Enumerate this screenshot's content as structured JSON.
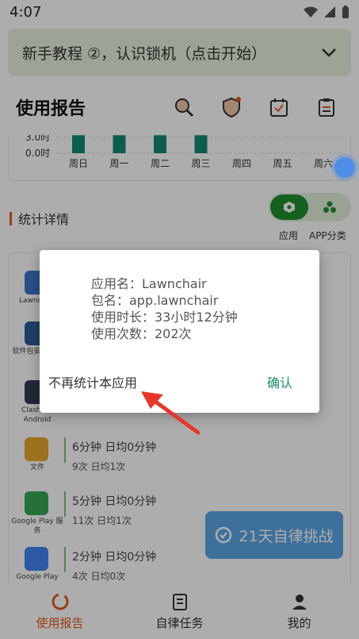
{
  "status_bar": {
    "time": "4:07"
  },
  "banner": {
    "text": "新手教程 ②，认识锁机（点击开始）"
  },
  "header": {
    "title": "使用报告",
    "tools": [
      "search-icon",
      "shield-icon",
      "calendar-check-icon",
      "clipboard-icon"
    ]
  },
  "chart_data": {
    "type": "bar",
    "categories": [
      "周日",
      "周一",
      "周二",
      "周三",
      "周四",
      "周五",
      "周六"
    ],
    "values": [
      3.4,
      3.4,
      3.4,
      3.4,
      0,
      0,
      0
    ],
    "ytick_labels": [
      "3.0时",
      "0.0时"
    ],
    "color": "#138a72"
  },
  "stats": {
    "title": "统计详情",
    "toggle_labels": [
      "应用",
      "APP分类"
    ]
  },
  "apps": [
    {
      "name": "Lawnchair",
      "duration": "",
      "count": "",
      "color": "#3b77c9"
    },
    {
      "name": "软件包安装程序",
      "duration": "",
      "count": "",
      "color": "#2d5f98"
    },
    {
      "name": "Clash for Android",
      "duration": "",
      "count": "",
      "color": "#2e3a55"
    },
    {
      "name": "文件",
      "duration": "6分钟  日均0分钟",
      "count": "9次  日均1次",
      "color": "#e9a72b"
    },
    {
      "name": "Google Play 服务",
      "duration": "5分钟  日均0分钟",
      "count": "11次  日均1次",
      "color": "#35a853"
    },
    {
      "name": "Google Play",
      "duration": "2分钟  日均0分钟",
      "count": "4次  日均0次",
      "color": "#4285f4"
    }
  ],
  "dialog": {
    "app_name": "应用名：Lawnchair",
    "package": "包名：app.lawnchair",
    "usage_time": "使用时长：33小时12分钟",
    "usage_count": "使用次数：202次",
    "ignore_label": "不再统计本应用",
    "confirm_label": "确认"
  },
  "challenge": {
    "label": "21天自律挑战"
  },
  "bottom_nav": [
    {
      "label": "使用报告",
      "icon": "report-icon",
      "active": true
    },
    {
      "label": "自律任务",
      "icon": "task-icon",
      "active": false
    },
    {
      "label": "我的",
      "icon": "profile-icon",
      "active": false
    }
  ]
}
